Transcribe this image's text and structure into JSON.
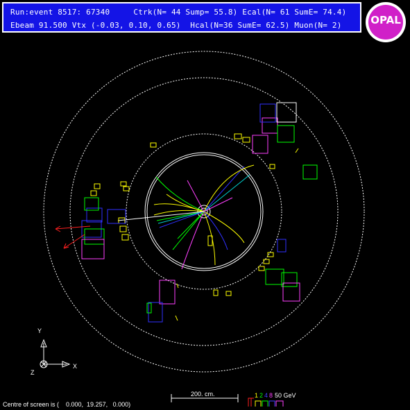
{
  "header": {
    "line1": "Run:event 8517: 67340     Ctrk(N= 44 Sump= 55.8) Ecal(N= 61 SumE= 74.4)",
    "line2": "Ebeam 91.500 Vtx (-0.03, 0.10, 0.65)  Hcal(N=36 SumE= 62.5) Muon(N= 2)"
  },
  "logo": {
    "text": "OPAL"
  },
  "axes": {
    "x": "X",
    "y": "Y",
    "z": "Z"
  },
  "scale": {
    "label": "200. cm."
  },
  "energy_scale": {
    "values": [
      "1",
      "2",
      "4",
      "8",
      "50 GeV"
    ],
    "colors": [
      "#ffff00",
      "#00ff00",
      "#4040ff",
      "#ff40ff",
      "#ffffff"
    ]
  },
  "footer": {
    "centre_text": "Centre of screen is (    0.000,  19.257,   0.000)"
  },
  "colors": {
    "background": "#000000",
    "header_bg": "#1414e6",
    "logo": "#d020c8"
  }
}
